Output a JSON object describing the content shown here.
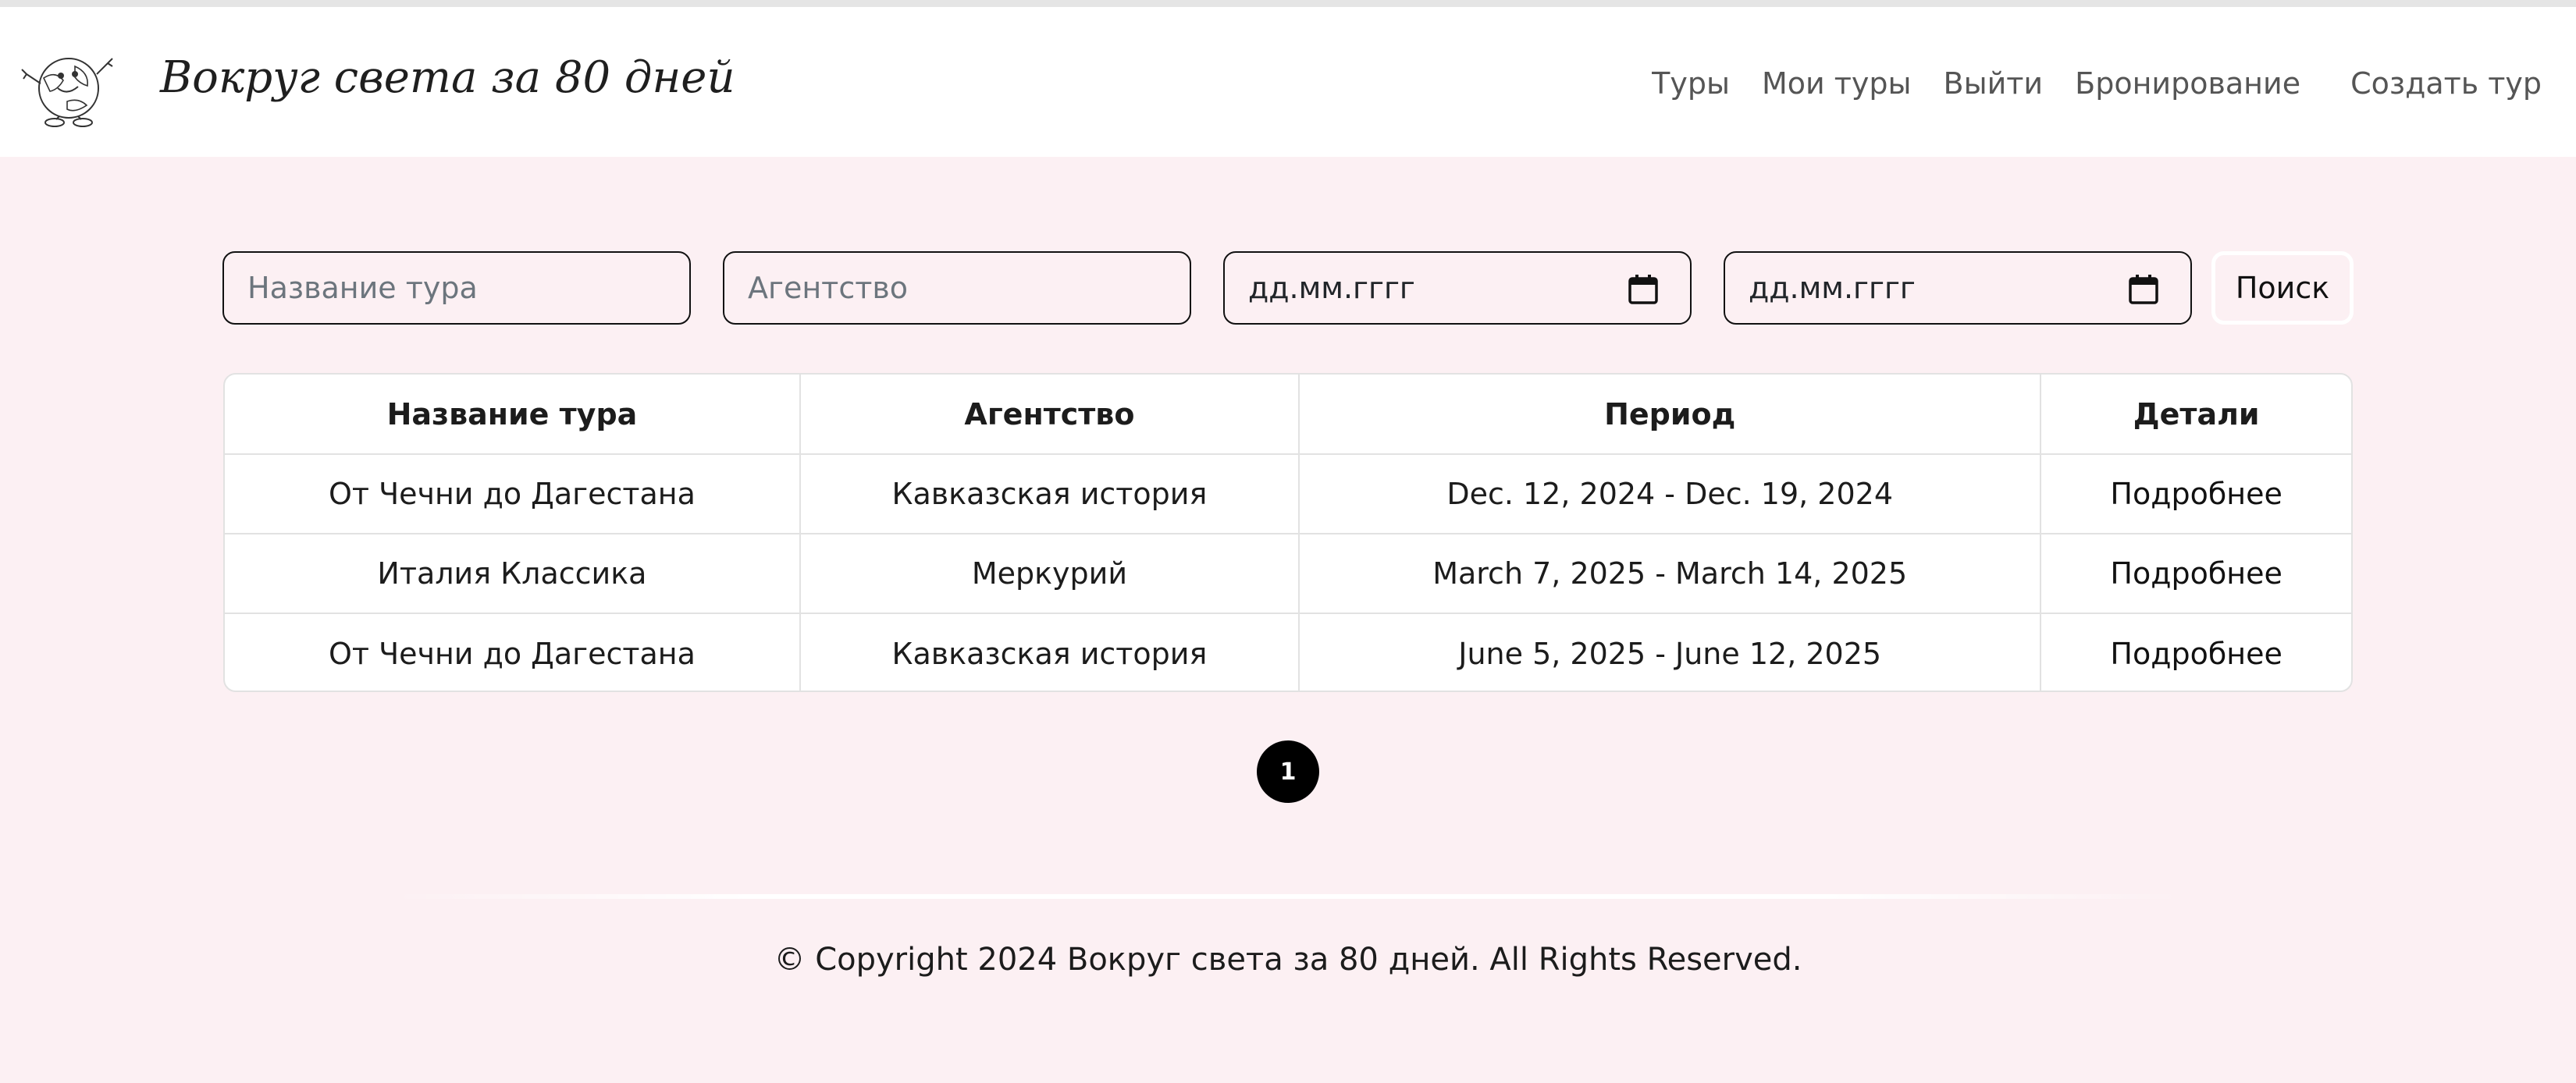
{
  "header": {
    "brand": "Вокруг света за 80 дней",
    "nav": [
      "Туры",
      "Мои туры",
      "Выйти",
      "Бронирование",
      "Создать тур"
    ]
  },
  "filters": {
    "tour_name_placeholder": "Название тура",
    "agency_placeholder": "Агентство",
    "date_from": "дд.мм.гггг",
    "date_to": "дд.мм.гггг",
    "search_label": "Поиск"
  },
  "table": {
    "columns": [
      "Название тура",
      "Агентство",
      "Период",
      "Детали"
    ],
    "rows": [
      [
        "От Чечни до Дагестана",
        "Кавказская история",
        "Dec. 12, 2024 - Dec. 19, 2024",
        "Подробнее"
      ],
      [
        "Италия Классика",
        "Меркурий",
        "March 7, 2025 - March 14, 2025",
        "Подробнее"
      ],
      [
        "От Чечни до Дагестана",
        "Кавказская история",
        "June 5, 2025 - June 12, 2025",
        "Подробнее"
      ]
    ]
  },
  "pagination": {
    "current_page": "1"
  },
  "footer": {
    "copyright": "© Copyright 2024 Вокруг света за 80 дней. All Rights Reserved."
  },
  "colors": {
    "page_bg": "#fcf0f3",
    "header_bg": "#ffffff",
    "pagination_bg": "#000000"
  }
}
